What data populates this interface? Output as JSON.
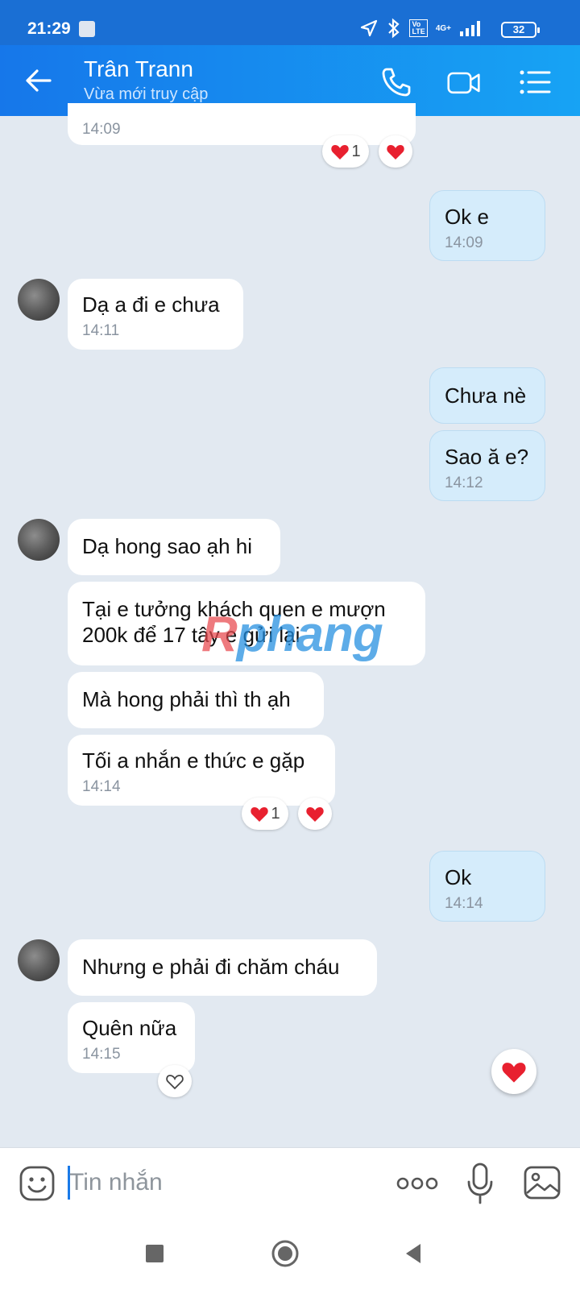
{
  "status": {
    "time": "21:29",
    "volte": "Vo\nLTE",
    "network": "4G+",
    "battery": "32"
  },
  "header": {
    "name": "Trân Trann",
    "presence": "Vừa mới truy cập"
  },
  "messages": [
    {
      "time": "14:09"
    },
    {
      "text": "Ok e",
      "time": "14:09"
    },
    {
      "text": "Dạ a đi e chưa",
      "time": "14:11"
    },
    {
      "text": "Chưa nè"
    },
    {
      "text": "Sao ă e?",
      "time": "14:12"
    },
    {
      "text": "Dạ hong sao ạh hi"
    },
    {
      "text": "Tại e tưởng khách quen e mượn 200k để 17 tây e gửi lại"
    },
    {
      "text": "Mà hong phải thì th ạh"
    },
    {
      "text": "Tối a nhắn e thức e gặp",
      "time": "14:14"
    },
    {
      "text": "Ok",
      "time": "14:14"
    },
    {
      "text": "Nhưng e phải đi chăm cháu"
    },
    {
      "text": "Quên nữa",
      "time": "14:15"
    }
  ],
  "reactions": {
    "r1_count": "1",
    "r2_count": "1"
  },
  "watermark": {
    "part1": "R",
    "part2": "phang"
  },
  "composer": {
    "placeholder": "Tin nhắn"
  },
  "colors": {
    "header": "#1677ea",
    "out_bubble": "#d5ecfb",
    "background": "#e2e9f1",
    "heart": "#e8202f"
  }
}
